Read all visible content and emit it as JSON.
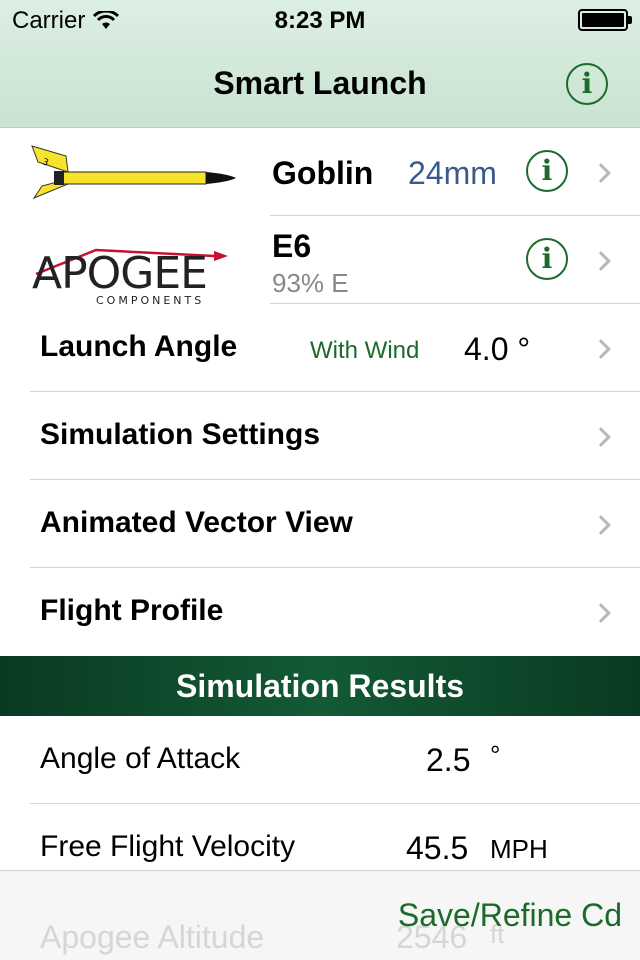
{
  "status": {
    "carrier": "Carrier",
    "time": "8:23 PM",
    "battery_level": 1.0
  },
  "nav": {
    "title": "Smart Launch",
    "info_symbol": "i"
  },
  "rocket": {
    "name": "Goblin",
    "size": "24mm",
    "info_symbol": "i"
  },
  "motor": {
    "brand": "APOGEE COMPONENTS",
    "brand_main": "APOGEE",
    "brand_sub": "COMPONENTS",
    "name": "E6",
    "sub": "93% E",
    "info_symbol": "i"
  },
  "launch_angle": {
    "label": "Launch Angle",
    "mode": "With Wind",
    "value": "4.0 °"
  },
  "menu": {
    "simulation_settings": "Simulation Settings",
    "animated_vector_view": "Animated Vector View",
    "flight_profile": "Flight Profile"
  },
  "results": {
    "header": "Simulation Results",
    "items": [
      {
        "label": "Angle of Attack",
        "value": "2.5",
        "unit": "°"
      },
      {
        "label": "Free Flight Velocity",
        "value": "45.5",
        "unit": "MPH"
      },
      {
        "label": "Apogee Altitude",
        "value": "2546",
        "unit": "ft"
      }
    ]
  },
  "toolbar": {
    "save_label": "Save/Refine Cd"
  },
  "colors": {
    "accent_green": "#1b6a2c",
    "header_green": "#0f4a2b",
    "size_blue": "#3a5a8a"
  }
}
